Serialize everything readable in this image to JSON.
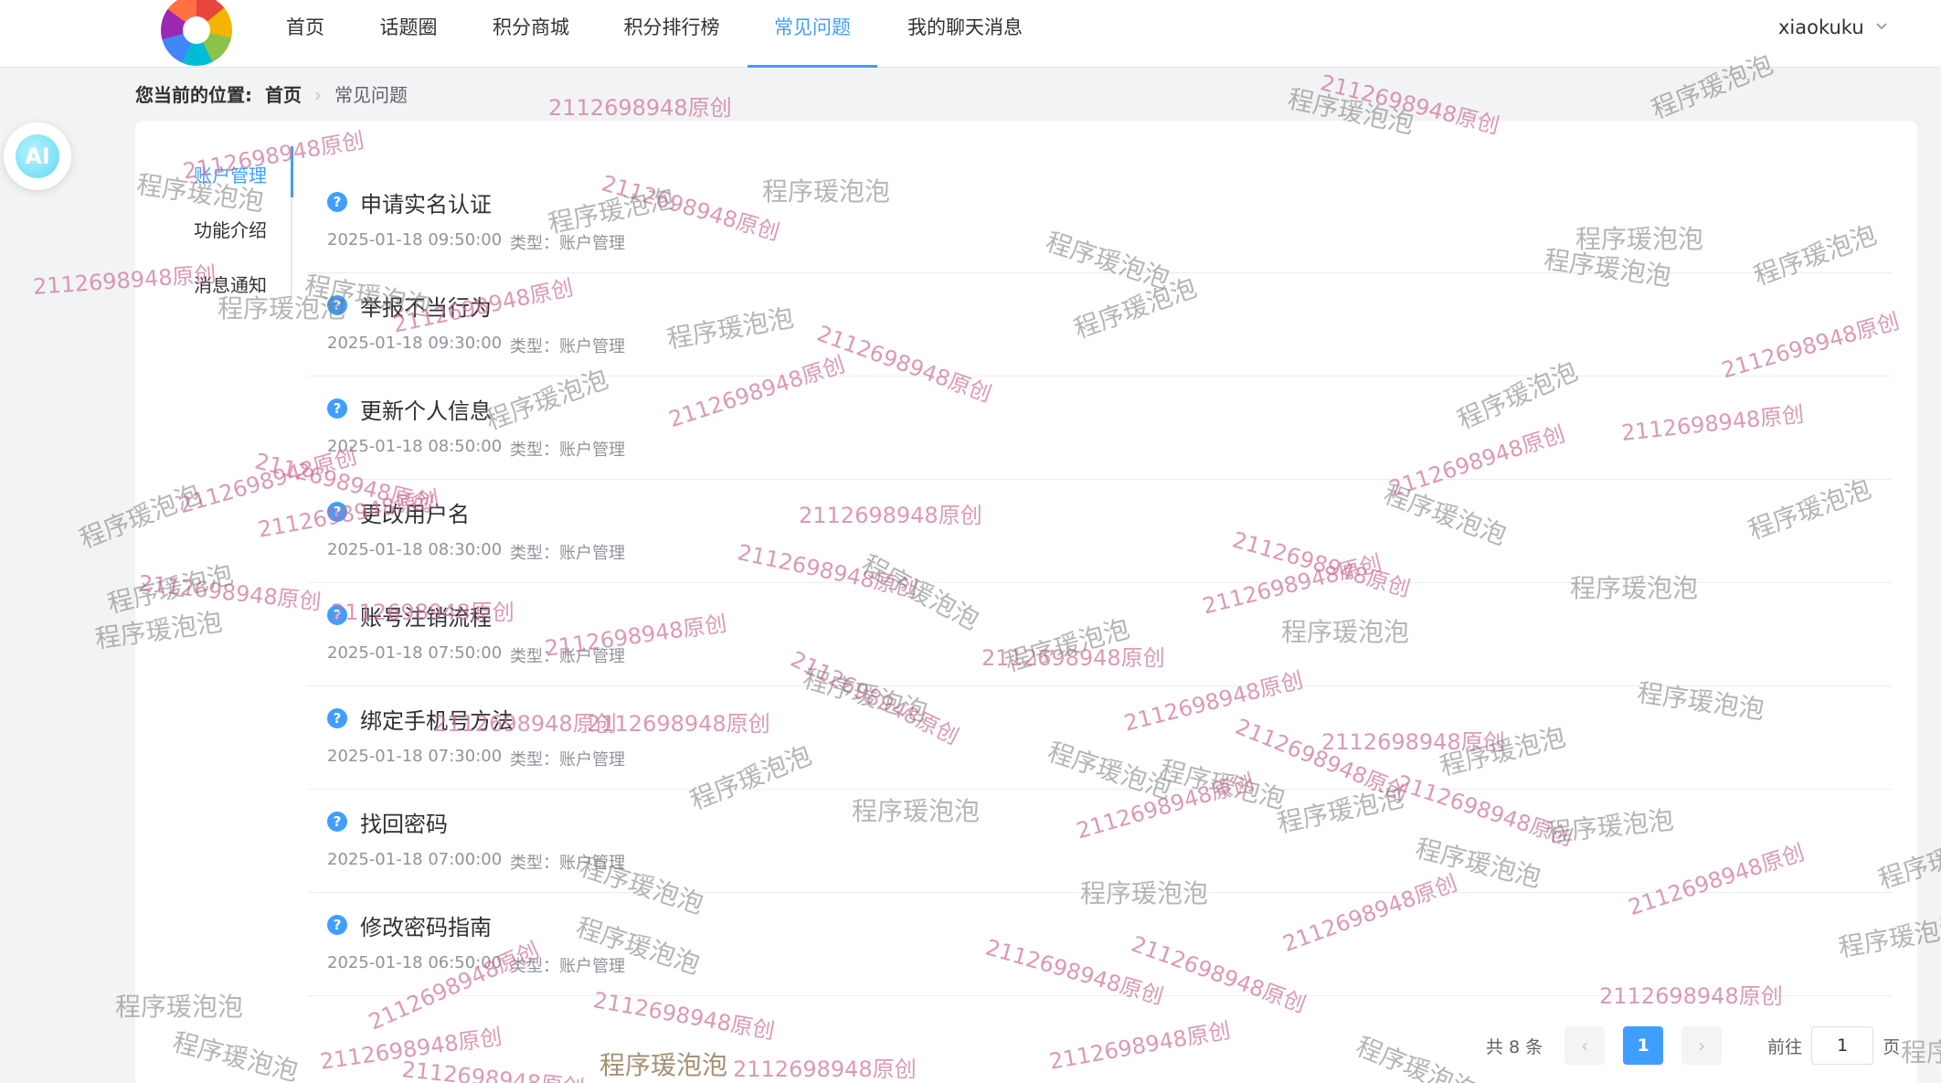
{
  "nav": {
    "items": [
      {
        "label": "首页"
      },
      {
        "label": "话题圈"
      },
      {
        "label": "积分商城"
      },
      {
        "label": "积分排行榜"
      },
      {
        "label": "常见问题"
      },
      {
        "label": "我的聊天消息"
      }
    ],
    "user": "xiaokuku"
  },
  "breadcrumb": {
    "prefix": "您当前的位置:",
    "home": "首页",
    "current": "常见问题"
  },
  "ai_button": {
    "label": "AI"
  },
  "side_menu": {
    "items": [
      {
        "label": "账户管理"
      },
      {
        "label": "功能介绍"
      },
      {
        "label": "消息通知"
      }
    ]
  },
  "faq": {
    "items": [
      {
        "title": "申请实名认证",
        "date": "2025-01-18 09:50:00",
        "type": "类型：账户管理"
      },
      {
        "title": "举报不当行为",
        "date": "2025-01-18 09:30:00",
        "type": "类型：账户管理"
      },
      {
        "title": "更新个人信息",
        "date": "2025-01-18 08:50:00",
        "type": "类型：账户管理"
      },
      {
        "title": "更改用户名",
        "date": "2025-01-18 08:30:00",
        "type": "类型：账户管理"
      },
      {
        "title": "账号注销流程",
        "date": "2025-01-18 07:50:00",
        "type": "类型：账户管理"
      },
      {
        "title": "绑定手机号方法",
        "date": "2025-01-18 07:30:00",
        "type": "类型：账户管理"
      },
      {
        "title": "找回密码",
        "date": "2025-01-18 07:00:00",
        "type": "类型：账户管理"
      },
      {
        "title": "修改密码指南",
        "date": "2025-01-18 06:50:00",
        "type": "类型：账户管理"
      }
    ]
  },
  "pagination": {
    "total": "共 8 条",
    "current_page": "1",
    "goto_prefix": "前往",
    "goto_value": "1",
    "goto_suffix": "页"
  },
  "watermark": {
    "text_a": "程序瑗泡泡",
    "text_b": "2112698948原创"
  }
}
